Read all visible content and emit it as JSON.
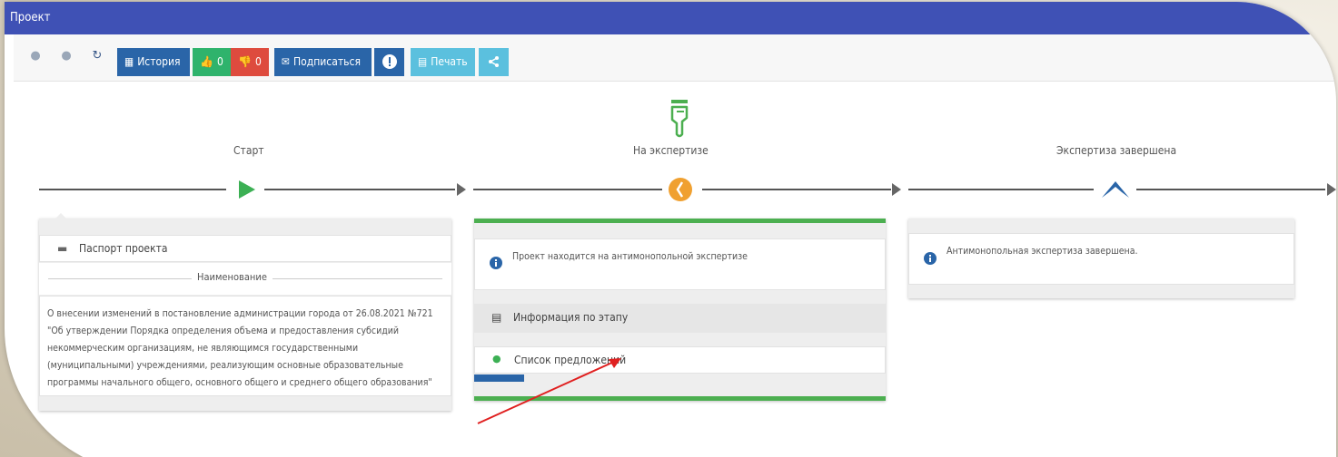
{
  "window": {
    "title": "Проект"
  },
  "toolbar": {
    "history": "История",
    "likes": "0",
    "dislikes": "0",
    "subscribe": "Подписаться",
    "print": "Печать"
  },
  "stages": [
    {
      "label": "Старт"
    },
    {
      "label": "На экспертизе"
    },
    {
      "label": "Экспертиза завершена"
    }
  ],
  "passport": {
    "header": "Паспорт проекта",
    "section": "Наименование",
    "text": "О внесении изменений в постановление администрации города от 26.08.2021 №721 \"Об утверждении Порядка определения объема и предоставления субсидий некоммерческим организациям, не являющимся государственными (муниципальными) учреждениями, реализующим основные образовательные программы начального общего, основного общего и среднего общего образования\""
  },
  "expertise": {
    "info": "Проект находится на антимонопольной экспертизе",
    "stage_info": "Информация по этапу",
    "proposals": "Список предложений"
  },
  "finished": {
    "info": "Антимонопольная экспертиза завершена."
  },
  "colors": {
    "title_bar": "#3f51b5",
    "primary": "#2a65a8",
    "success": "#2fb36c",
    "danger": "#de4b3e",
    "info": "#5bc0de",
    "progress_green": "#4caf50",
    "stage_orange": "#f0a030",
    "annotation_arrow": "#e02020"
  }
}
